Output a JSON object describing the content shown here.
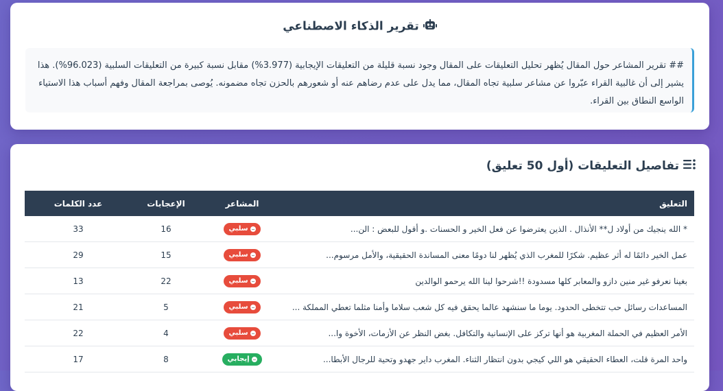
{
  "ai_report": {
    "title": "تقرير الذكاء الاصطناعي",
    "icon": "robot-icon",
    "text": "## تقرير المشاعر حول المقال يُظهر تحليل التعليقات على المقال وجود نسبة قليلة من التعليقات الإيجابية (3.977%) مقابل نسبة كبيرة من التعليقات السلبية (96.023%). هذا يشير إلى أن غالبية القراء عبّروا عن مشاعر سلبية تجاه المقال، مما يدل على عدم رضاهم عنه أو شعورهم بالحزن تجاه مضمونه. يُوصى بمراجعة المقال وفهم أسباب هذا الاستياء الواسع النطاق بين القراء."
  },
  "comments_table": {
    "title": "تفاصيل التعليقات (أول 50 تعليق)",
    "icon": "list-icon",
    "headers": {
      "comment": "التعليق",
      "sentiment": "المشاعر",
      "likes": "الإعجابات",
      "words": "عدد الكلمات"
    },
    "rows": [
      {
        "comment": "* الله ينجيك من أولاد ل** الأنذال . الذين يعترضوا عن فعل الخير و الحسنات .و أقول للبعض : الن...",
        "sentiment": "سلبي",
        "type": "neg",
        "likes": "16",
        "words": "33"
      },
      {
        "comment": "عمل الخير دائمًا له أثر عظيم. شكرًا للمغرب الذي يُظهر لنا دومًا معنى المساندة الحقيقية، والأمل مرسوم...",
        "sentiment": "سلبي",
        "type": "neg",
        "likes": "15",
        "words": "29"
      },
      {
        "comment": "بغينا نعرفو غير منين دازو والمعابر كلها مسدودة !!شرحوا لينا الله يرحمو الوالدين",
        "sentiment": "سلبي",
        "type": "neg",
        "likes": "22",
        "words": "13"
      },
      {
        "comment": "المساعدات رسائل حب تتخطى الحدود. يوما ما سنشهد عالما يحقق فيه كل شعب سلاما وأمنا مثلما تعطي المملكة ...",
        "sentiment": "سلبي",
        "type": "neg",
        "likes": "5",
        "words": "21"
      },
      {
        "comment": "الأمر العظيم في الحملة المغربية هو أنها تركز على الإنسانية والتكافل. بغض النظر عن الأزمات، الأخوة وا...",
        "sentiment": "سلبي",
        "type": "neg",
        "likes": "4",
        "words": "22"
      },
      {
        "comment": "واحد المرة قلت، العطاء الحقيقي هو اللي كيجي بدون انتظار الثناء. المغرب داير جهدو وتحية للرجال الأبطا...",
        "sentiment": "إيجابي",
        "type": "pos",
        "likes": "8",
        "words": "17"
      }
    ]
  },
  "colors": {
    "background": "#7060c4",
    "header_row": "#2d3e52",
    "negative": "#e74c3c",
    "positive": "#27ae60",
    "accent_border": "#3aa0d8"
  }
}
